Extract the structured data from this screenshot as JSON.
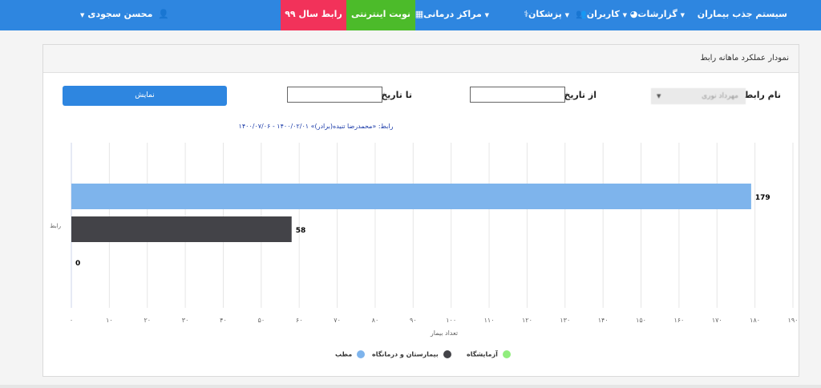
{
  "nav": {
    "brand": "سیستم جذب بیماران",
    "reports": "گزارشات",
    "users": "کاربران",
    "doctors": "پزشکان",
    "centers": "مراکز درمانی",
    "online_turn": "نوبت اینترنتی",
    "liaison_99": "رابط سال ۹۹",
    "user_name": "محسن سجودی"
  },
  "panel": {
    "title": "نمودار عملکرد ماهانه رابط"
  },
  "filters": {
    "liaison_label": "نام رابط",
    "liaison_value": "مهرداد نوری",
    "from_label": "از تاریخ",
    "from_value": "",
    "to_label": "تا تاریخ",
    "to_value": "",
    "show_button": "نمایش"
  },
  "colors": {
    "matab": "#7eb4ec",
    "hospital": "#434348",
    "lab": "#90ed7d"
  },
  "chart_data": {
    "type": "bar",
    "orientation": "horizontal",
    "title": "رابط: «محمدرضا تنیده(برادر)» ۱۴۰۰/۰۲/۰۱ - ۱۴۰۰/۰۷/۰۶",
    "categories": [
      "رابط"
    ],
    "series": [
      {
        "name": "مطب",
        "values": [
          179
        ]
      },
      {
        "name": "بیمارستان و درمانگاه",
        "values": [
          58
        ]
      },
      {
        "name": "آزمایشگاه",
        "values": [
          0
        ]
      }
    ],
    "xlabel": "تعداد بیمار",
    "xlim": [
      0,
      190
    ],
    "xticks": [
      "۰",
      "۱۰",
      "۲۰",
      "۳۰",
      "۴۰",
      "۵۰",
      "۶۰",
      "۷۰",
      "۸۰",
      "۹۰",
      "۱۰۰",
      "۱۱۰",
      "۱۲۰",
      "۱۳۰",
      "۱۴۰",
      "۱۵۰",
      "۱۶۰",
      "۱۷۰",
      "۱۸۰",
      "۱۹۰"
    ],
    "grid": true,
    "legend": "bottom"
  }
}
